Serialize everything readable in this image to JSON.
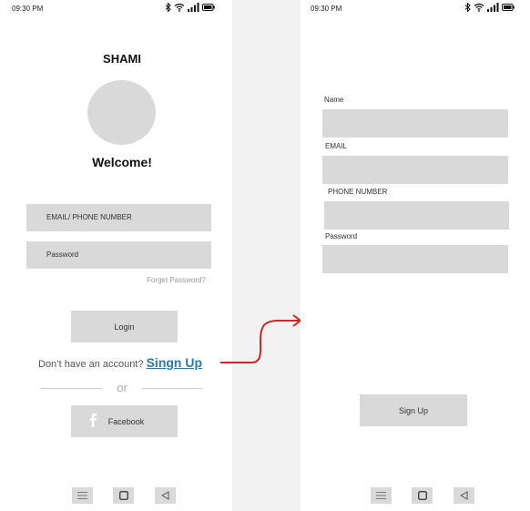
{
  "login": {
    "status_time": "09:30 PM",
    "app_name": "SHAMI",
    "welcome": "Welcome!",
    "email_placeholder": "EMAIL/ PHONE NUMBER",
    "password_placeholder": "Password",
    "forgot_password": "Forget Password?",
    "login_label": "Login",
    "no_account_text": "Don’t have an account?",
    "signup_link": "Singn Up",
    "or_text": "or",
    "facebook_label": "Facebook"
  },
  "signup": {
    "status_time": "09:30 PM",
    "name_label": "Name",
    "email_label": "EMAIL",
    "phone_label": "PHONE NUMBER",
    "password_label": "Password",
    "signup_button_label": "Sign Up"
  },
  "colors": {
    "placeholder_gray": "#d9d9d9",
    "link_blue": "#2d7aa8",
    "arrow_red": "#c62828"
  },
  "icons": {
    "status": [
      "bluetooth-icon",
      "wifi-icon",
      "signal-icon",
      "battery-icon"
    ],
    "nav": [
      "menu-icon",
      "home-square-icon",
      "back-triangle-icon"
    ],
    "social": "facebook-icon"
  }
}
